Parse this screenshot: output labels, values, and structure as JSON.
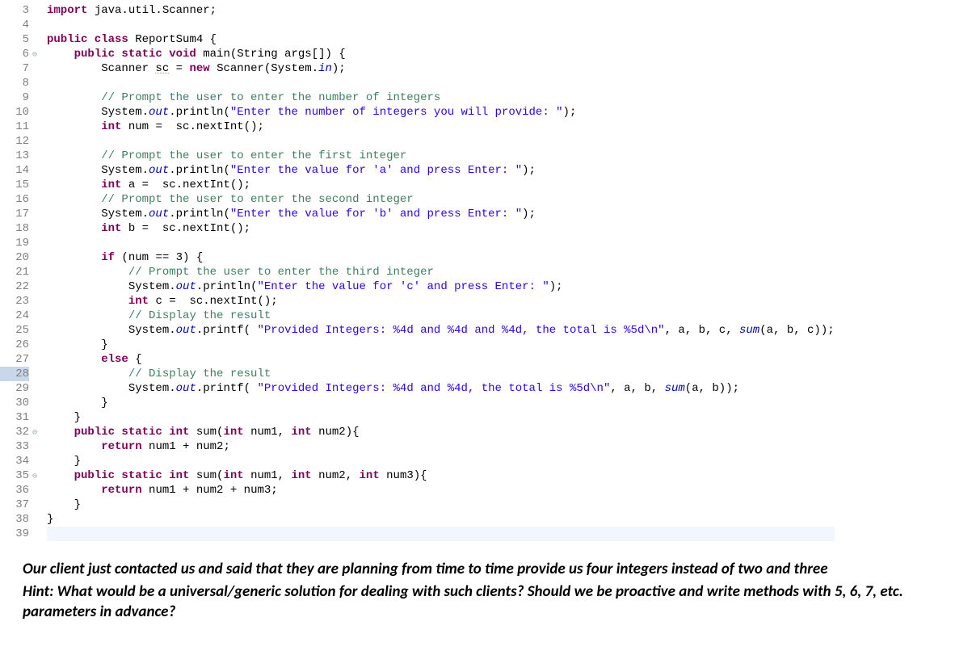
{
  "gutter_start": 3,
  "gutter_end": 39,
  "fold_lines": [
    6,
    32,
    35
  ],
  "highlighted_lineno": 28,
  "cursor_line": 39,
  "lines": [
    {
      "n": 3,
      "tokens": [
        [
          "kw",
          "import"
        ],
        [
          "pln",
          " java.util.Scanner;"
        ]
      ]
    },
    {
      "n": 4,
      "tokens": []
    },
    {
      "n": 5,
      "tokens": [
        [
          "kw",
          "public class"
        ],
        [
          "pln",
          " ReportSum4 {"
        ]
      ]
    },
    {
      "n": 6,
      "tokens": [
        [
          "pln",
          "    "
        ],
        [
          "kw",
          "public static void"
        ],
        [
          "pln",
          " main(String args[]) {"
        ]
      ]
    },
    {
      "n": 7,
      "tokens": [
        [
          "pln",
          "        Scanner "
        ],
        [
          "underwarn",
          "sc"
        ],
        [
          "pln",
          " = "
        ],
        [
          "kw",
          "new"
        ],
        [
          "pln",
          " Scanner(System."
        ],
        [
          "fld",
          "in"
        ],
        [
          "pln",
          ");"
        ]
      ]
    },
    {
      "n": 8,
      "tokens": []
    },
    {
      "n": 9,
      "tokens": [
        [
          "pln",
          "        "
        ],
        [
          "cm",
          "// Prompt the user to enter the number of integers"
        ]
      ]
    },
    {
      "n": 10,
      "tokens": [
        [
          "pln",
          "        System."
        ],
        [
          "fld",
          "out"
        ],
        [
          "pln",
          ".println("
        ],
        [
          "str",
          "\"Enter the number of integers you will provide: \""
        ],
        [
          "pln",
          ");"
        ]
      ]
    },
    {
      "n": 11,
      "tokens": [
        [
          "pln",
          "        "
        ],
        [
          "kw",
          "int"
        ],
        [
          "pln",
          " num =  sc.nextInt();"
        ]
      ]
    },
    {
      "n": 12,
      "tokens": []
    },
    {
      "n": 13,
      "tokens": [
        [
          "pln",
          "        "
        ],
        [
          "cm",
          "// Prompt the user to enter the first integer"
        ]
      ]
    },
    {
      "n": 14,
      "tokens": [
        [
          "pln",
          "        System."
        ],
        [
          "fld",
          "out"
        ],
        [
          "pln",
          ".println("
        ],
        [
          "str",
          "\"Enter the value for 'a' and press Enter: \""
        ],
        [
          "pln",
          ");"
        ]
      ]
    },
    {
      "n": 15,
      "tokens": [
        [
          "pln",
          "        "
        ],
        [
          "kw",
          "int"
        ],
        [
          "pln",
          " a =  sc.nextInt();"
        ]
      ]
    },
    {
      "n": 16,
      "tokens": [
        [
          "pln",
          "        "
        ],
        [
          "cm",
          "// Prompt the user to enter the second integer"
        ]
      ]
    },
    {
      "n": 17,
      "tokens": [
        [
          "pln",
          "        System."
        ],
        [
          "fld",
          "out"
        ],
        [
          "pln",
          ".println("
        ],
        [
          "str",
          "\"Enter the value for 'b' and press Enter: \""
        ],
        [
          "pln",
          ");"
        ]
      ]
    },
    {
      "n": 18,
      "tokens": [
        [
          "pln",
          "        "
        ],
        [
          "kw",
          "int"
        ],
        [
          "pln",
          " b =  sc.nextInt();"
        ]
      ]
    },
    {
      "n": 19,
      "tokens": []
    },
    {
      "n": 20,
      "tokens": [
        [
          "pln",
          "        "
        ],
        [
          "kw",
          "if"
        ],
        [
          "pln",
          " (num == 3) {"
        ]
      ]
    },
    {
      "n": 21,
      "tokens": [
        [
          "pln",
          "            "
        ],
        [
          "cm",
          "// Prompt the user to enter the third integer"
        ]
      ]
    },
    {
      "n": 22,
      "tokens": [
        [
          "pln",
          "            System."
        ],
        [
          "fld",
          "out"
        ],
        [
          "pln",
          ".println("
        ],
        [
          "str",
          "\"Enter the value for 'c' and press Enter: \""
        ],
        [
          "pln",
          ");"
        ]
      ]
    },
    {
      "n": 23,
      "tokens": [
        [
          "pln",
          "            "
        ],
        [
          "kw",
          "int"
        ],
        [
          "pln",
          " c =  sc.nextInt();"
        ]
      ]
    },
    {
      "n": 24,
      "tokens": [
        [
          "pln",
          "            "
        ],
        [
          "cm",
          "// Display the result"
        ]
      ]
    },
    {
      "n": 25,
      "tokens": [
        [
          "pln",
          "            System."
        ],
        [
          "fld",
          "out"
        ],
        [
          "pln",
          ".printf( "
        ],
        [
          "str",
          "\"Provided Integers: %4d and %4d and %4d, the total is %5d\\n\""
        ],
        [
          "pln",
          ", a, b, c, "
        ],
        [
          "fld",
          "sum"
        ],
        [
          "pln",
          "(a, b, c));"
        ]
      ]
    },
    {
      "n": 26,
      "tokens": [
        [
          "pln",
          "        }"
        ]
      ]
    },
    {
      "n": 27,
      "tokens": [
        [
          "pln",
          "        "
        ],
        [
          "kw",
          "else"
        ],
        [
          "pln",
          " {"
        ]
      ]
    },
    {
      "n": 28,
      "tokens": [
        [
          "pln",
          "            "
        ],
        [
          "cm",
          "// Display the result"
        ]
      ]
    },
    {
      "n": 29,
      "tokens": [
        [
          "pln",
          "            System."
        ],
        [
          "fld",
          "out"
        ],
        [
          "pln",
          ".printf( "
        ],
        [
          "str",
          "\"Provided Integers: %4d and %4d, the total is %5d\\n\""
        ],
        [
          "pln",
          ", a, b, "
        ],
        [
          "fld",
          "sum"
        ],
        [
          "pln",
          "(a, b));"
        ]
      ]
    },
    {
      "n": 30,
      "tokens": [
        [
          "pln",
          "        }"
        ]
      ]
    },
    {
      "n": 31,
      "tokens": [
        [
          "pln",
          "    }"
        ]
      ]
    },
    {
      "n": 32,
      "tokens": [
        [
          "pln",
          "    "
        ],
        [
          "kw",
          "public static int"
        ],
        [
          "pln",
          " sum("
        ],
        [
          "kw",
          "int"
        ],
        [
          "pln",
          " num1, "
        ],
        [
          "kw",
          "int"
        ],
        [
          "pln",
          " num2){"
        ]
      ]
    },
    {
      "n": 33,
      "tokens": [
        [
          "pln",
          "        "
        ],
        [
          "kw",
          "return"
        ],
        [
          "pln",
          " num1 + num2;"
        ]
      ]
    },
    {
      "n": 34,
      "tokens": [
        [
          "pln",
          "    }"
        ]
      ]
    },
    {
      "n": 35,
      "tokens": [
        [
          "pln",
          "    "
        ],
        [
          "kw",
          "public static int"
        ],
        [
          "pln",
          " sum("
        ],
        [
          "kw",
          "int"
        ],
        [
          "pln",
          " num1, "
        ],
        [
          "kw",
          "int"
        ],
        [
          "pln",
          " num2, "
        ],
        [
          "kw",
          "int"
        ],
        [
          "pln",
          " num3){"
        ]
      ]
    },
    {
      "n": 36,
      "tokens": [
        [
          "pln",
          "        "
        ],
        [
          "kw",
          "return"
        ],
        [
          "pln",
          " num1 + num2 + num3;"
        ]
      ]
    },
    {
      "n": 37,
      "tokens": [
        [
          "pln",
          "    }"
        ]
      ]
    },
    {
      "n": 38,
      "tokens": [
        [
          "pln",
          "}"
        ]
      ]
    },
    {
      "n": 39,
      "tokens": []
    }
  ],
  "caption": {
    "line1": "Our client just contacted us and said that they are planning from time to time provide us four integers instead of two and three",
    "line2": "Hint: What would be a universal/generic solution for dealing with such clients? Should we be proactive and write methods with 5, 6, 7, etc. parameters in advance?"
  }
}
